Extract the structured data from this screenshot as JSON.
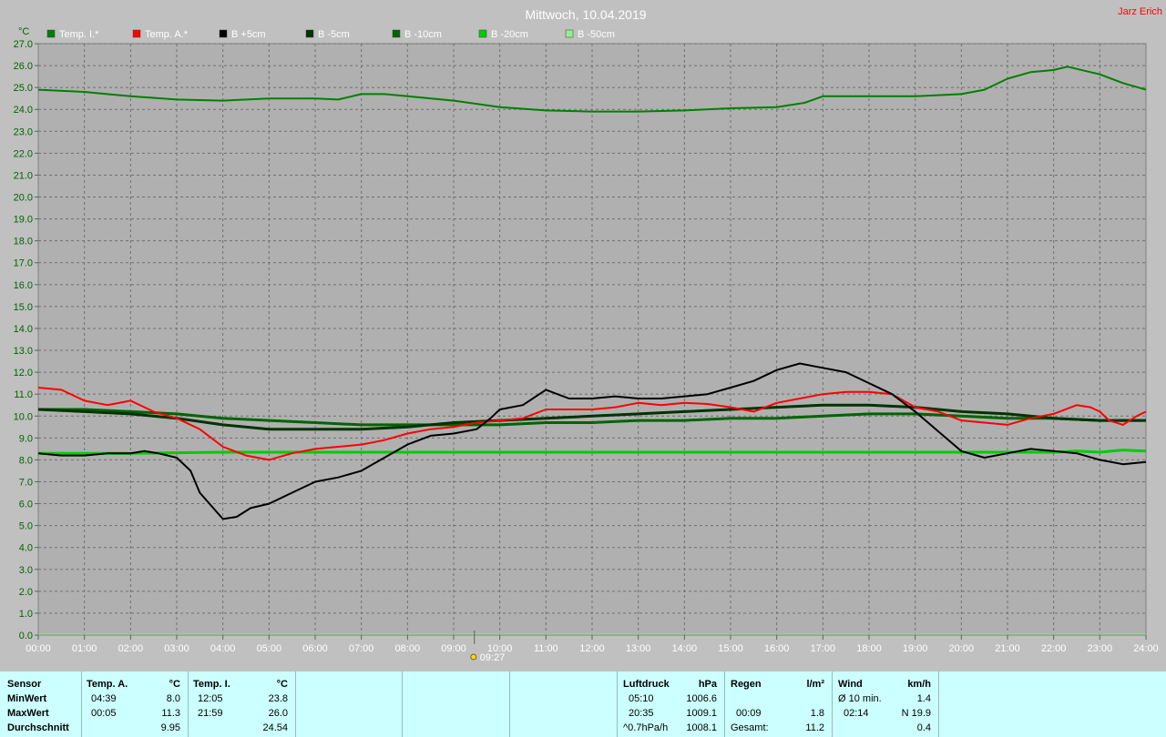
{
  "title": "Mittwoch, 10.04.2019",
  "author": "Jarz Erich",
  "chart_data": {
    "type": "line",
    "y_unit": "°C",
    "ylim": [
      0,
      27
    ],
    "y_ticks": [
      "0.0",
      "1.0",
      "2.0",
      "3.0",
      "4.0",
      "5.0",
      "6.0",
      "7.0",
      "8.0",
      "9.0",
      "10.0",
      "11.0",
      "12.0",
      "13.0",
      "14.0",
      "15.0",
      "16.0",
      "17.0",
      "18.0",
      "19.0",
      "20.0",
      "21.0",
      "22.0",
      "23.0",
      "24.0",
      "25.0",
      "26.0",
      "27.0"
    ],
    "x_ticks": [
      "00:00",
      "01:00",
      "02:00",
      "03:00",
      "04:00",
      "05:00",
      "06:00",
      "07:00",
      "08:00",
      "09:00",
      "10:00",
      "11:00",
      "12:00",
      "13:00",
      "14:00",
      "15:00",
      "16:00",
      "17:00",
      "18:00",
      "19:00",
      "20:00",
      "21:00",
      "22:00",
      "23:00",
      "24:00"
    ],
    "xlim": [
      0,
      24
    ],
    "grid": true,
    "legend_position": "top-left",
    "marker": {
      "time": 9.45,
      "label": "09:27"
    },
    "series": [
      {
        "name": "Temp. I.*",
        "color": "#008000",
        "width": 2,
        "x": [
          0,
          1,
          2,
          3,
          4,
          5,
          6,
          6.5,
          7,
          7.5,
          8,
          9,
          10,
          11,
          12,
          13,
          14,
          15,
          16,
          16.6,
          17,
          18,
          19,
          19.5,
          20,
          20.5,
          21,
          21.5,
          22,
          22.3,
          23,
          23.5,
          24
        ],
        "y": [
          24.9,
          24.8,
          24.6,
          24.45,
          24.4,
          24.5,
          24.5,
          24.45,
          24.7,
          24.7,
          24.6,
          24.4,
          24.1,
          23.95,
          23.9,
          23.9,
          23.95,
          24.05,
          24.1,
          24.3,
          24.6,
          24.6,
          24.6,
          24.65,
          24.7,
          24.9,
          25.4,
          25.7,
          25.8,
          25.95,
          25.6,
          25.2,
          24.9
        ]
      },
      {
        "name": "Temp. A.*",
        "color": "#ff0000",
        "width": 2,
        "x": [
          0,
          0.5,
          1,
          1.5,
          2,
          2.5,
          3,
          3.5,
          4,
          4.5,
          5,
          5.5,
          6,
          6.5,
          7,
          7.5,
          8,
          8.5,
          9,
          9.5,
          10,
          10.5,
          11,
          11.5,
          12,
          12.5,
          13,
          13.5,
          14,
          14.5,
          15,
          15.5,
          16,
          16.5,
          17,
          17.5,
          18,
          18.5,
          19,
          19.5,
          20,
          20.5,
          21,
          21.5,
          22,
          22.5,
          22.8,
          23,
          23.2,
          23.5,
          23.8,
          24
        ],
        "y": [
          11.3,
          11.2,
          10.7,
          10.5,
          10.7,
          10.2,
          9.9,
          9.4,
          8.6,
          8.2,
          8.0,
          8.3,
          8.5,
          8.6,
          8.7,
          8.9,
          9.2,
          9.4,
          9.5,
          9.7,
          9.8,
          9.9,
          10.3,
          10.3,
          10.3,
          10.4,
          10.6,
          10.5,
          10.6,
          10.55,
          10.4,
          10.2,
          10.6,
          10.8,
          11.0,
          11.1,
          11.1,
          11.0,
          10.4,
          10.2,
          9.8,
          9.7,
          9.6,
          9.9,
          10.1,
          10.5,
          10.4,
          10.2,
          9.8,
          9.6,
          10.0,
          10.2
        ]
      },
      {
        "name": "B +5cm",
        "color": "#000000",
        "width": 2,
        "x": [
          0,
          0.5,
          1,
          1.5,
          2,
          2.3,
          2.6,
          3,
          3.3,
          3.5,
          4,
          4.3,
          4.6,
          5,
          5.5,
          6,
          6.5,
          7,
          7.5,
          8,
          8.5,
          9,
          9.5,
          9.8,
          10,
          10.5,
          11,
          11.5,
          12,
          12.5,
          13,
          13.5,
          14,
          14.5,
          15,
          15.5,
          16,
          16.5,
          17,
          17.5,
          18,
          18.5,
          19,
          19.5,
          20,
          20.5,
          21,
          21.5,
          22,
          22.5,
          23,
          23.5,
          24
        ],
        "y": [
          8.3,
          8.2,
          8.2,
          8.3,
          8.3,
          8.4,
          8.3,
          8.1,
          7.5,
          6.5,
          5.3,
          5.4,
          5.8,
          6.0,
          6.5,
          7.0,
          7.2,
          7.5,
          8.1,
          8.7,
          9.1,
          9.2,
          9.4,
          9.9,
          10.3,
          10.5,
          11.2,
          10.8,
          10.8,
          10.9,
          10.8,
          10.8,
          10.9,
          11.0,
          11.3,
          11.6,
          12.1,
          12.4,
          12.2,
          12.0,
          11.5,
          11.0,
          10.2,
          9.3,
          8.4,
          8.1,
          8.3,
          8.5,
          8.4,
          8.3,
          8.0,
          7.8,
          7.9
        ]
      },
      {
        "name": "B -5cm",
        "color": "#003300",
        "width": 3,
        "x": [
          0,
          1,
          2,
          3,
          4,
          5,
          6,
          7,
          8,
          9,
          10,
          11,
          12,
          13,
          14,
          15,
          16,
          17,
          18,
          19,
          20,
          21,
          22,
          23,
          24
        ],
        "y": [
          10.3,
          10.2,
          10.1,
          9.9,
          9.6,
          9.4,
          9.4,
          9.4,
          9.5,
          9.7,
          9.8,
          9.9,
          10.0,
          10.1,
          10.2,
          10.3,
          10.4,
          10.5,
          10.5,
          10.4,
          10.2,
          10.1,
          9.9,
          9.8,
          9.8
        ]
      },
      {
        "name": "B -10cm",
        "color": "#006400",
        "width": 3,
        "x": [
          0,
          1,
          2,
          3,
          4,
          5,
          6,
          7,
          8,
          9,
          10,
          11,
          12,
          13,
          14,
          15,
          16,
          17,
          18,
          19,
          20,
          21,
          22,
          23,
          24
        ],
        "y": [
          10.3,
          10.3,
          10.2,
          10.1,
          9.9,
          9.8,
          9.7,
          9.6,
          9.6,
          9.6,
          9.6,
          9.7,
          9.7,
          9.8,
          9.8,
          9.9,
          9.9,
          10.0,
          10.1,
          10.1,
          10.0,
          9.9,
          9.9,
          9.8,
          9.8
        ]
      },
      {
        "name": "B -20cm",
        "color": "#00cc00",
        "width": 3,
        "x": [
          0,
          2,
          4,
          6,
          8,
          10,
          12,
          14,
          16,
          18,
          20,
          22,
          22.5,
          23,
          23.5,
          24
        ],
        "y": [
          8.3,
          8.3,
          8.35,
          8.35,
          8.35,
          8.35,
          8.35,
          8.35,
          8.35,
          8.35,
          8.35,
          8.35,
          8.4,
          8.35,
          8.45,
          8.4
        ]
      },
      {
        "name": "B -50cm",
        "color": "#90ee90",
        "width": 2,
        "x": [],
        "y": []
      }
    ]
  },
  "stats": {
    "row_labels": [
      "Sensor",
      "MinWert",
      "MaxWert",
      "Durchschnitt"
    ],
    "temp_a": {
      "header": "Temp. A.",
      "unit": "°C",
      "min_time": "04:39",
      "min": "8.0",
      "max_time": "00:05",
      "max": "11.3",
      "avg": "9.95"
    },
    "temp_i": {
      "header": "Temp. I.",
      "unit": "°C",
      "min_time": "12:05",
      "min": "23.8",
      "max_time": "21:59",
      "max": "26.0",
      "avg": "24.54"
    },
    "luftdruck": {
      "header": "Luftdruck",
      "unit": "hPa",
      "min_time": "05:10",
      "min": "1006.6",
      "max_time": "20:35",
      "max": "1009.1",
      "trend_label": "^0.7hPa/h",
      "avg": "1008.1"
    },
    "regen": {
      "header": "Regen",
      "unit": "l/m²",
      "max_time": "00:09",
      "max": "1.8",
      "total_label": "Gesamt:",
      "total": "11.2"
    },
    "wind": {
      "header": "Wind",
      "unit": "km/h",
      "avg10_label": "Ø 10 min.",
      "avg10": "1.4",
      "gust_time": "02:14",
      "gust": "N 19.9",
      "avg": "0.4"
    }
  }
}
